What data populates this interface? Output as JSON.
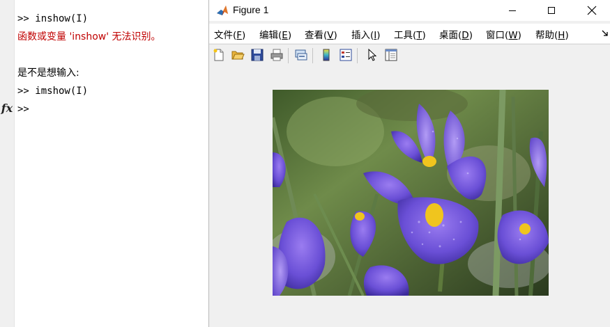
{
  "command_window": {
    "lines": [
      {
        "text": ">> inshow(I)"
      },
      {
        "text": "函数或变量 'inshow' 无法识别。"
      },
      {
        "text": "是不是想输入:"
      },
      {
        "text": ">> imshow(I)"
      },
      {
        "text": ">>"
      }
    ],
    "fx_label": "fx"
  },
  "figure": {
    "title": "Figure 1",
    "window_buttons": {
      "minimize": "minimize",
      "maximize": "maximize",
      "close": "close"
    },
    "menus": [
      {
        "label": "文件(",
        "key": "F",
        "tail": ")"
      },
      {
        "label": "编辑(",
        "key": "E",
        "tail": ")"
      },
      {
        "label": "查看(",
        "key": "V",
        "tail": ")"
      },
      {
        "label": "插入(",
        "key": "I",
        "tail": ")"
      },
      {
        "label": "工具(",
        "key": "T",
        "tail": ")"
      },
      {
        "label": "桌面(",
        "key": "D",
        "tail": ")"
      },
      {
        "label": "窗口(",
        "key": "W",
        "tail": ")"
      },
      {
        "label": "帮助(",
        "key": "H",
        "tail": ")"
      }
    ],
    "toolbar_icons": [
      "new-figure-icon",
      "open-folder-icon",
      "save-icon",
      "print-icon",
      "link-icon",
      "colorbar-icon",
      "legend-icon",
      "pointer-icon",
      "property-inspector-icon"
    ],
    "image": "iris flower photo"
  },
  "colors": {
    "error_text": "#c00000",
    "menu_bg": "#ffffff",
    "figure_bg": "#f0f0f0"
  }
}
